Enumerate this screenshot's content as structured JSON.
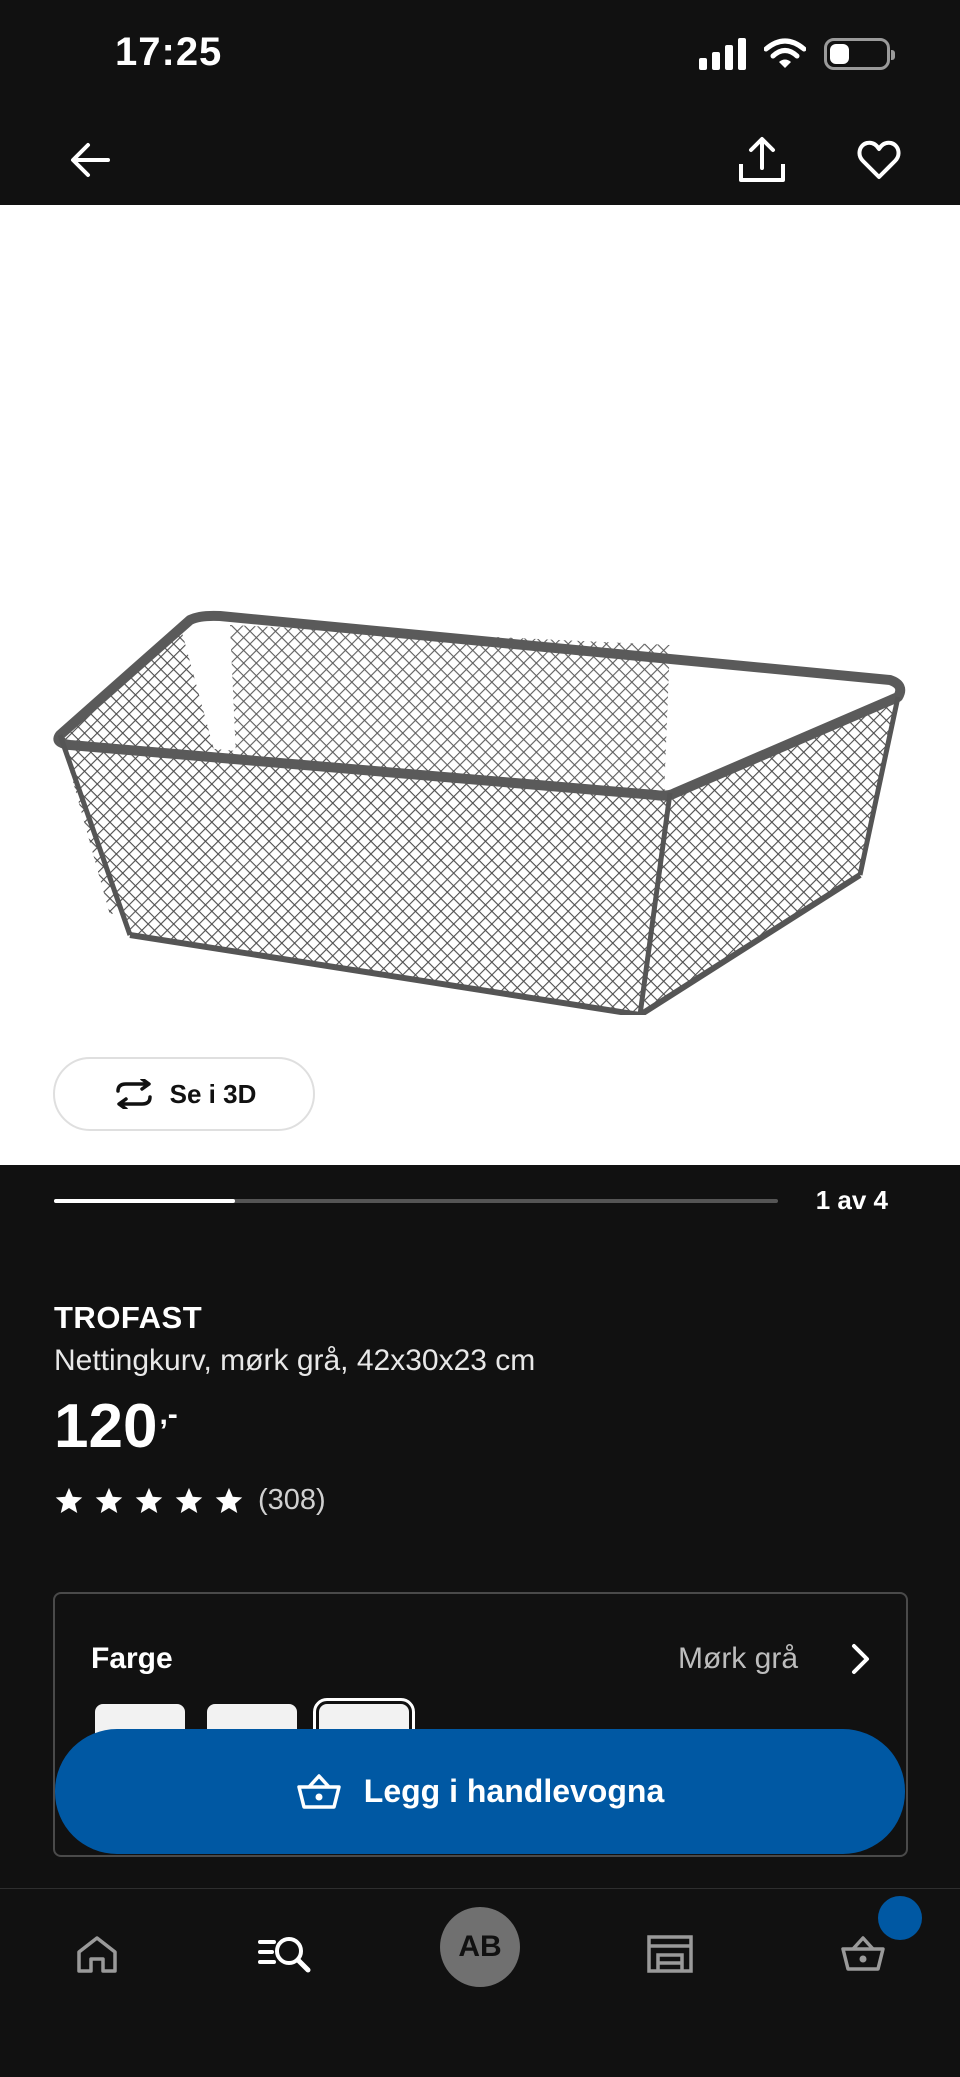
{
  "status_bar": {
    "time": "17:25",
    "battery_level": 0.35
  },
  "nav": {
    "back_icon": "arrow-left-icon",
    "share_icon": "share-icon",
    "favorite_icon": "heart-icon"
  },
  "gallery": {
    "view_3d_label": "Se i 3D",
    "page_indicator": "1 av 4",
    "progress": 0.25
  },
  "product": {
    "brand": "TROFAST",
    "description": "Nettingkurv, mørk grå, 42x30x23 cm",
    "price": "120",
    "price_suffix": ",-",
    "rating_stars": 5,
    "review_count": "(308)"
  },
  "color": {
    "label": "Farge",
    "value": "Mørk grå",
    "swatch_count": 3,
    "selected_index": 2
  },
  "cart_button": {
    "label": "Legg i handlevogna",
    "icon": "basket-icon"
  },
  "tab_bar": {
    "items": [
      "home-icon",
      "search-list-icon",
      "profile-avatar",
      "store-icon",
      "basket-icon"
    ],
    "avatar_initials": "AB"
  },
  "colors": {
    "background": "#111111",
    "accent": "#0058a3",
    "image_bg": "#ffffff"
  }
}
